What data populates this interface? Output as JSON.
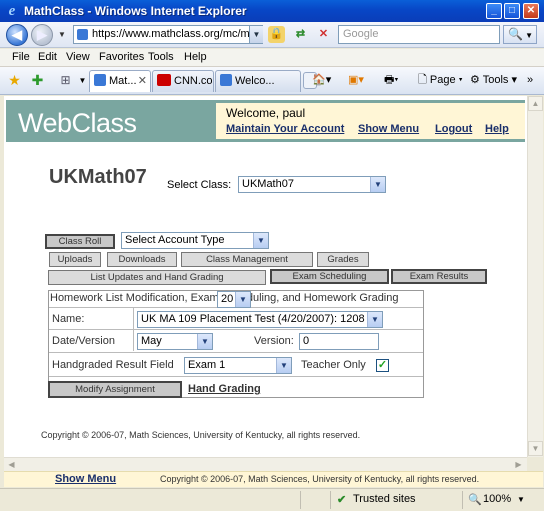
{
  "window": {
    "title": "MathClass - Windows Internet Explorer",
    "buttons": {
      "minimize": "_",
      "maximize": "□",
      "close": "✕"
    }
  },
  "address": {
    "url": "https://www.mathclass.org/mc/menuF",
    "search_placeholder": "Google"
  },
  "menu": [
    "File",
    "Edit",
    "View",
    "Favorites",
    "Tools",
    "Help"
  ],
  "tabs": [
    {
      "label": "Mat...",
      "active": true
    },
    {
      "label": "CNN.co...",
      "active": false
    },
    {
      "label": "Welco...",
      "active": false
    }
  ],
  "commands": {
    "page": "Page",
    "tools": "Tools"
  },
  "header": {
    "logo": "WebClass",
    "welcome": "Welcome, paul",
    "links": [
      "Maintain Your Account",
      "Show Menu",
      "Logout",
      "Help"
    ]
  },
  "main": {
    "title": "UKMath07",
    "select_class_label": "Select Class:",
    "select_class_value": "UKMath07",
    "account_type_value": "Select Account Type",
    "buttons": {
      "class_roll": "Class Roll",
      "uploads": "Uploads",
      "downloads": "Downloads",
      "class_management": "Class Management",
      "grades": "Grades",
      "list_updates": "List Updates and Hand Grading",
      "exam_scheduling": "Exam Scheduling",
      "exam_results": "Exam Results"
    }
  },
  "panel": {
    "heading": "Homework List Modification, Exam Scheduling, and Homework Grading",
    "name_label": "Name:",
    "name_value": "UK MA 109 Placement Test (4/20/2007): 1208",
    "date_label": "Date/Version",
    "month_value": "May",
    "day_value": "20",
    "version_label": "Version:",
    "version_value": "0",
    "handgraded_label": "Handgraded Result Field",
    "handgraded_value": "Exam 1",
    "teacher_only_label": "Teacher Only",
    "teacher_only_checked": true,
    "modify_button": "Modify Assignment",
    "hand_grading_link": "Hand Grading"
  },
  "copyright": "Copyright © 2006-07, Math Sciences, University of Kentucky, all rights reserved.",
  "footer": {
    "show_menu": "Show Menu",
    "copyright": "Copyright © 2006-07, Math Sciences, University of Kentucky, all rights reserved."
  },
  "status": {
    "zone": "Trusted sites",
    "zoom": "100%"
  }
}
